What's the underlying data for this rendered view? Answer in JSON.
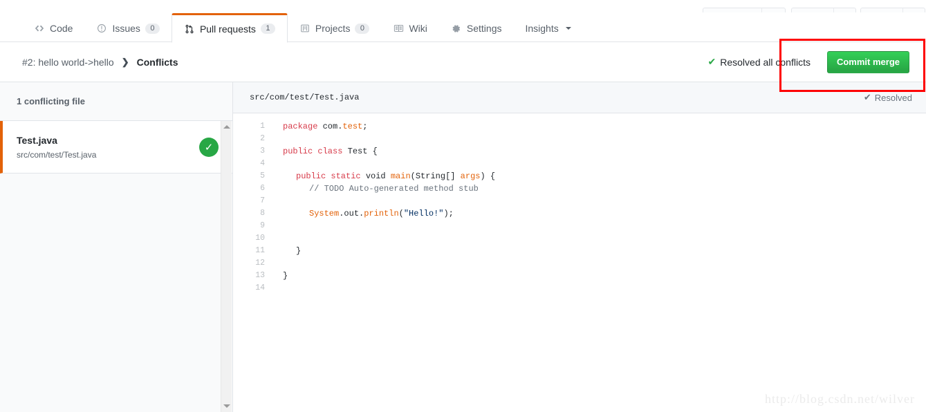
{
  "top_strip": {
    "ghost_buttons": [
      {
        "name": "ghost-button-1"
      },
      {
        "name": "ghost-button-2"
      },
      {
        "name": "ghost-button-3"
      }
    ]
  },
  "nav": {
    "items": [
      {
        "label": "Code",
        "icon": "code-icon",
        "count": null,
        "active": false
      },
      {
        "label": "Issues",
        "icon": "issue-opened-icon",
        "count": "0",
        "active": false
      },
      {
        "label": "Pull requests",
        "icon": "git-pull-request-icon",
        "count": "1",
        "active": true
      },
      {
        "label": "Projects",
        "icon": "project-board-icon",
        "count": "0",
        "active": false
      },
      {
        "label": "Wiki",
        "icon": "book-icon",
        "count": null,
        "active": false
      },
      {
        "label": "Settings",
        "icon": "gear-icon",
        "count": null,
        "active": false
      },
      {
        "label": "Insights",
        "icon": "caret-down-icon",
        "count": null,
        "active": false
      }
    ]
  },
  "pr_header": {
    "breadcrumb_link": "#2: hello world->hello",
    "breadcrumb_separator": "❯",
    "breadcrumb_current": "Conflicts",
    "resolved_all_label": "Resolved all conflicts",
    "resolved_all_icon": "check-icon",
    "commit_button_label": "Commit merge"
  },
  "sidebar": {
    "heading": "1 conflicting file",
    "files": [
      {
        "name": "Test.java",
        "path": "src/com/test/Test.java",
        "status_icon": "check-circle-icon",
        "status": "resolved"
      }
    ],
    "scrollbar": {
      "up_icon": "scroll-up-arrow-icon",
      "down_icon": "scroll-down-arrow-icon"
    }
  },
  "code_pane": {
    "file_path": "src/com/test/Test.java",
    "status_icon": "check-icon",
    "status_label": "Resolved",
    "lines": [
      {
        "n": "1",
        "tokens": [
          {
            "t": "package ",
            "c": "k"
          },
          {
            "t": "com.",
            "c": "p"
          },
          {
            "t": "test",
            "c": "t"
          },
          {
            "t": ";",
            "c": "p"
          }
        ],
        "indent": 0
      },
      {
        "n": "2",
        "tokens": [],
        "indent": 0
      },
      {
        "n": "3",
        "tokens": [
          {
            "t": "public class ",
            "c": "k"
          },
          {
            "t": "Test",
            "c": "p"
          },
          {
            "t": " {",
            "c": "p"
          }
        ],
        "indent": 0
      },
      {
        "n": "4",
        "tokens": [],
        "indent": 0
      },
      {
        "n": "5",
        "tokens": [
          {
            "t": "public static ",
            "c": "k"
          },
          {
            "t": "void ",
            "c": "p"
          },
          {
            "t": "main",
            "c": "t"
          },
          {
            "t": "(String[] ",
            "c": "p"
          },
          {
            "t": "args",
            "c": "t"
          },
          {
            "t": ") {",
            "c": "p"
          }
        ],
        "indent": 1
      },
      {
        "n": "6",
        "tokens": [
          {
            "t": "// TODO Auto-generated method stub",
            "c": "c"
          }
        ],
        "indent": 2
      },
      {
        "n": "7",
        "tokens": [],
        "indent": 0
      },
      {
        "n": "8",
        "tokens": [
          {
            "t": "System",
            "c": "t"
          },
          {
            "t": ".out.",
            "c": "p"
          },
          {
            "t": "println",
            "c": "t"
          },
          {
            "t": "(",
            "c": "p"
          },
          {
            "t": "\"Hello!\"",
            "c": "s"
          },
          {
            "t": ");",
            "c": "p"
          }
        ],
        "indent": 2
      },
      {
        "n": "9",
        "tokens": [],
        "indent": 0
      },
      {
        "n": "10",
        "tokens": [],
        "indent": 0
      },
      {
        "n": "11",
        "tokens": [
          {
            "t": "}",
            "c": "p"
          }
        ],
        "indent": 1
      },
      {
        "n": "12",
        "tokens": [],
        "indent": 0
      },
      {
        "n": "13",
        "tokens": [
          {
            "t": "}",
            "c": "p"
          }
        ],
        "indent": 0
      },
      {
        "n": "14",
        "tokens": [],
        "indent": 0
      }
    ]
  },
  "annotation": {
    "name": "red-highlight-box",
    "color": "#fe0000"
  },
  "watermark": {
    "text": "http://blog.csdn.net/wilver"
  },
  "colors": {
    "accent_orange": "#e36209",
    "green": "#28a745",
    "border": "#e1e4e8",
    "muted_text": "#586069",
    "annotation_red": "#fe0000"
  }
}
